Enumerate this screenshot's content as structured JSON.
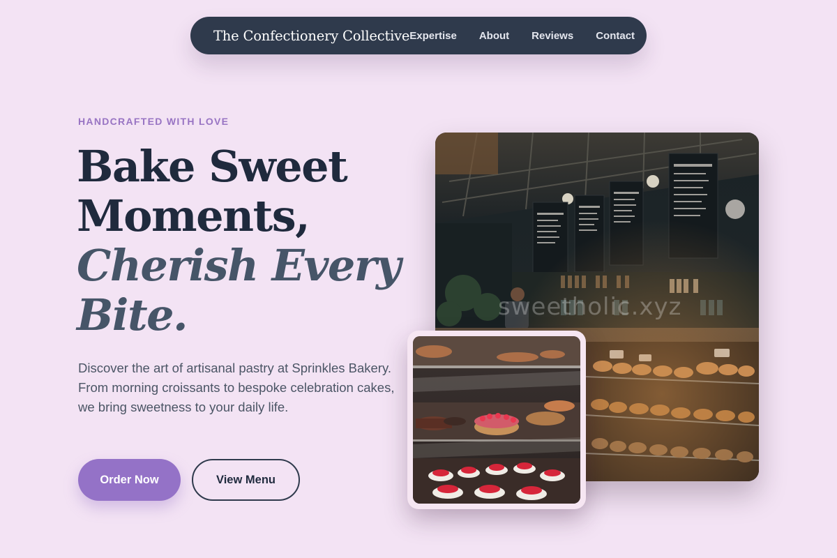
{
  "nav": {
    "brand": "The Confectionery Collective",
    "links": [
      "Expertise",
      "About",
      "Reviews",
      "Contact"
    ]
  },
  "hero": {
    "eyebrow": "HANDCRAFTED WITH LOVE",
    "headline_line1": "Bake Sweet",
    "headline_line2": "Moments,",
    "headline_line3": "Cherish Every",
    "headline_line4": "Bite.",
    "description": "Discover the art of artisanal pastry at Sprinkles Bakery. From morning croissants to bespoke celebration cakes, we bring sweetness to your daily life.",
    "primary_cta": "Order Now",
    "secondary_cta": "View Menu"
  },
  "images": {
    "main_watermark": "sweetholic.xyz"
  },
  "colors": {
    "background": "#f3e3f4",
    "nav": "#2f3a4c",
    "accent": "#9472c7",
    "heading": "#1f2a3d"
  }
}
